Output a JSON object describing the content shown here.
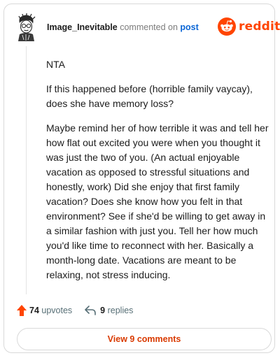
{
  "header": {
    "username": "Image_Inevitable",
    "commented_on": "commented on",
    "post_link": "post",
    "brand": "reddit"
  },
  "comment": {
    "paragraphs": [
      "NTA",
      "If this happened before (horrible family vaycay), does she have memory loss?",
      "Maybe remind her of how terrible it was and tell her how flat out excited you were when you thought it was just the two of you. (An actual enjoyable vacation as opposed to stressful situations and honestly, work) Did she enjoy that first family vacation? Does she know how you felt in that environment? See if she'd be willing to get away in a similar fashion with just you. Tell her how much you'd like time to reconnect with her. Basically a month-long date. Vacations are meant to be relaxing, not stress inducing."
    ]
  },
  "actions": {
    "upvote_icon": "upvote-arrow-icon",
    "upvote_count": "74",
    "upvote_word": "upvotes",
    "reply_icon": "reply-arrow-icon",
    "reply_count": "9",
    "reply_word": "replies"
  },
  "footer": {
    "view_comments_label": "View 9 comments"
  },
  "colors": {
    "brand_orange": "#ff4500",
    "link_blue": "#0a66d6",
    "button_text": "#d93a00"
  }
}
